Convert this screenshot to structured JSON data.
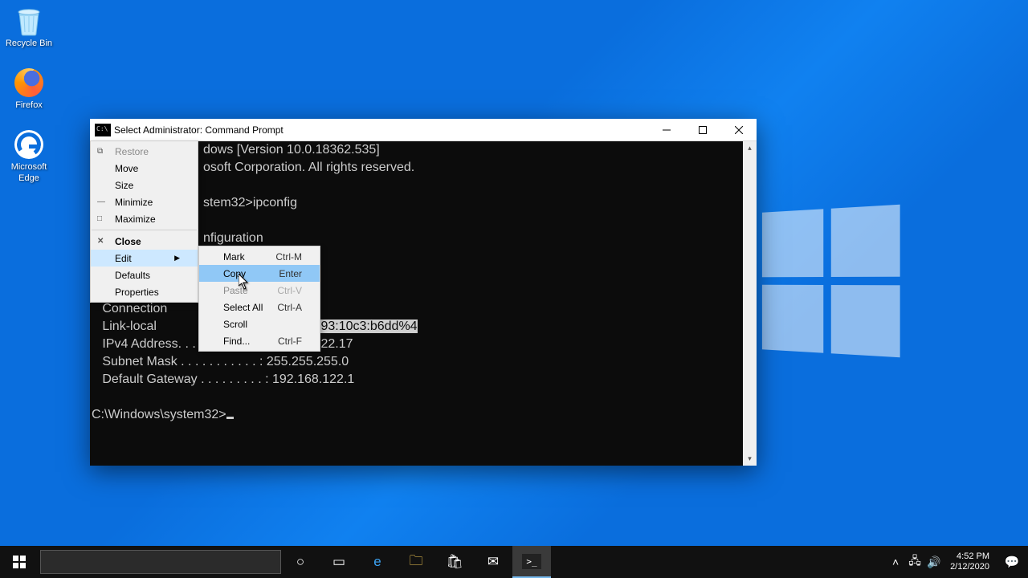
{
  "desktop": {
    "icons": [
      {
        "label": "Recycle Bin"
      },
      {
        "label": "Firefox"
      },
      {
        "label": "Microsoft Edge"
      }
    ]
  },
  "window": {
    "title": "Select Administrator: Command Prompt"
  },
  "terminal": {
    "line1a": "dows [Version 10.0.18362.535]",
    "line2a": "osoft Corporation. All rights reserved.",
    "line4a": "stem32>ipconfig",
    "line6a": "nfiguration",
    "line10": "   Connection              uffix  . :",
    "line11a": "   Link-local              . . . . : ",
    "line11sel": "fe80::b58e:1893:10c3:b6dd%4",
    "line12": "   IPv4 Address. . . . . . . . . . . : 192.168.122.17",
    "line13": "   Subnet Mask . . . . . . . . . . . : 255.255.255.0",
    "line14": "   Default Gateway . . . . . . . . . : 192.168.122.1",
    "prompt": "C:\\Windows\\system32>"
  },
  "sysmenu": {
    "restore": "Restore",
    "move": "Move",
    "size": "Size",
    "minimize": "Minimize",
    "maximize": "Maximize",
    "close": "Close",
    "edit": "Edit",
    "defaults": "Defaults",
    "properties": "Properties"
  },
  "editmenu": {
    "mark": "Mark",
    "mark_k": "Ctrl-M",
    "copy": "Copy",
    "copy_k": "Enter",
    "paste": "Paste",
    "paste_k": "Ctrl-V",
    "selectall": "Select All",
    "selectall_k": "Ctrl-A",
    "scroll": "Scroll",
    "find": "Find...",
    "find_k": "Ctrl-F"
  },
  "taskbar": {
    "time": "4:52 PM",
    "date": "2/12/2020"
  }
}
